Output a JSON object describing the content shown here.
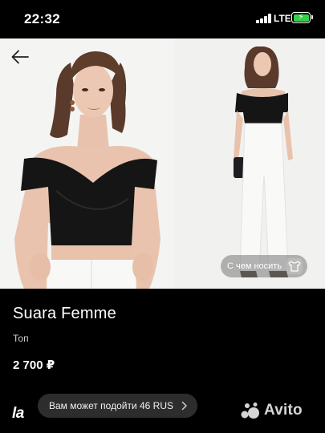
{
  "status_bar": {
    "time": "22:32",
    "network": "LTE",
    "signal_icon": "cellular-signal-icon",
    "battery_icon": "battery-charging-icon",
    "battery_color": "#35d04b"
  },
  "gallery": {
    "back_icon": "arrow-left-icon",
    "outfit_chip_label": "С чем носить",
    "outfit_icon": "shirt-icon",
    "image_count": 2
  },
  "product": {
    "brand": "Suara Femme",
    "category": "Топ",
    "price": "2 700 ₽"
  },
  "bottom_bar": {
    "logo": "la",
    "size_hint": "Вам может подойти 46 RUS",
    "size_hint_icon": "chevron-right-icon",
    "watermark": "Avito"
  },
  "colors": {
    "background": "#000000",
    "chip_background": "#2d2d2d",
    "top_color": "#151515",
    "jeans_color": "#f7f7f5"
  }
}
